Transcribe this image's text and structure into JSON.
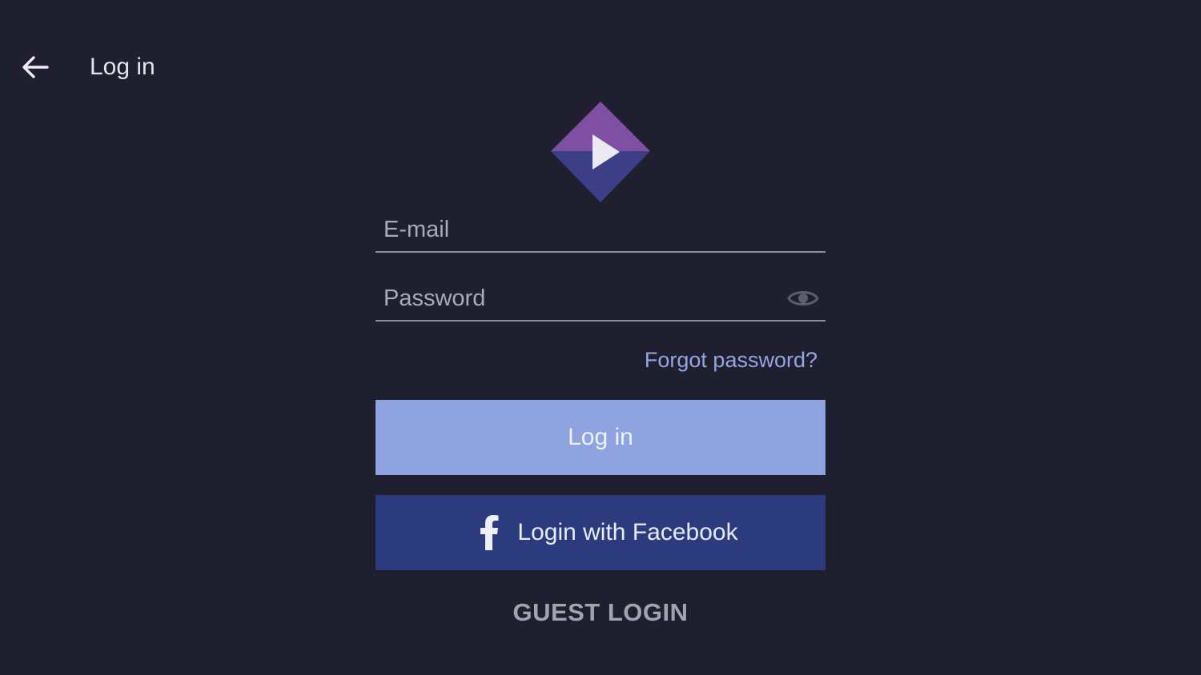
{
  "header": {
    "title": "Log in",
    "back_icon": "arrow-left-icon"
  },
  "logo": {
    "icon": "play-diamond-logo",
    "colors": {
      "top": "#7e4fa3",
      "bottom": "#3d3f86",
      "play": "#ece9f3"
    }
  },
  "form": {
    "email": {
      "placeholder": "E-mail",
      "value": ""
    },
    "password": {
      "placeholder": "Password",
      "value": "",
      "toggle_icon": "eye-icon"
    },
    "forgot_password_label": "Forgot password?",
    "login_button_label": "Log in",
    "facebook_button_label": "Login with Facebook",
    "facebook_icon": "facebook-icon",
    "guest_login_label": "GUEST LOGIN"
  },
  "colors": {
    "background": "#1f1f30",
    "login_button": "#8ea3df",
    "facebook_button": "#2b3b7e",
    "link": "#94a6e4"
  }
}
